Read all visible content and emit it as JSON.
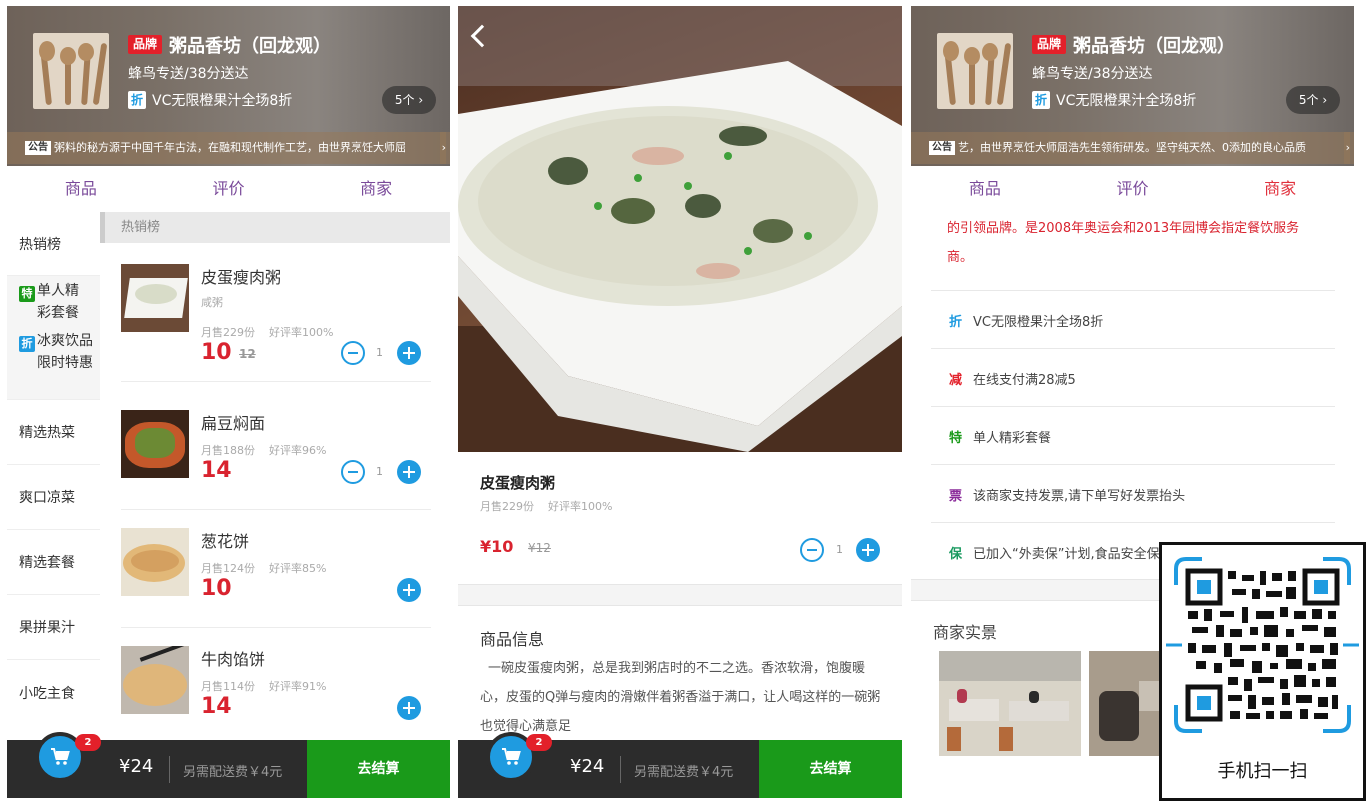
{
  "shop": {
    "brand_tag": "品牌",
    "name": "粥品香坊（回龙观）",
    "delivery": "蜂鸟专送/38分送达",
    "promo_icon": "折",
    "promo": "VC无限橙果汁全场8折",
    "promo_count": "5个 ›",
    "notice_tag": "公告",
    "notice_p1": "粥料的秘方源于中国千年古法，在融和现代制作工艺，由世界烹饪大师屈",
    "notice_p3": "艺，由世界烹饪大师屈浩先生领衔研发。坚守纯天然、0添加的良心品质",
    "notice_arrow": "›"
  },
  "tabs": [
    "商品",
    "评价",
    "商家"
  ],
  "categories": [
    {
      "label": "热销榜"
    },
    {
      "tag": "特",
      "tag_color": "#1a9a1a",
      "label": "单人精彩套餐"
    },
    {
      "tag": "折",
      "tag_color": "#1f9be0",
      "label": "冰爽饮品限时特惠"
    },
    {
      "label": "精选热菜"
    },
    {
      "label": "爽口凉菜"
    },
    {
      "label": "精选套餐"
    },
    {
      "label": "果拼果汁"
    },
    {
      "label": "小吃主食"
    }
  ],
  "section_title": "热销榜",
  "products": [
    {
      "name": "皮蛋瘦肉粥",
      "desc": "咸粥",
      "sales": "月售229份",
      "rating": "好评率100%",
      "price": "10",
      "old_price": "12",
      "qty": "1"
    },
    {
      "name": "扁豆焖面",
      "desc": "",
      "sales": "月售188份",
      "rating": "好评率96%",
      "price": "14",
      "old_price": "",
      "qty": "1"
    },
    {
      "name": "葱花饼",
      "desc": "",
      "sales": "月售124份",
      "rating": "好评率85%",
      "price": "10",
      "old_price": "",
      "qty": ""
    },
    {
      "name": "牛肉馅饼",
      "desc": "",
      "sales": "月售114份",
      "rating": "好评率91%",
      "price": "14",
      "old_price": "",
      "qty": ""
    }
  ],
  "cart": {
    "badge": "2",
    "total": "¥24",
    "delivery_fee": "另需配送费￥4元",
    "checkout": "去结算"
  },
  "detail": {
    "name": "皮蛋瘦肉粥",
    "sales": "月售229份",
    "rating": "好评率100%",
    "price": "¥10",
    "old_price": "¥12",
    "qty": "1",
    "info_title": "商品信息",
    "info_body": "一碗皮蛋瘦肉粥，总是我到粥店时的不二之选。香浓软滑，饱腹暖心，皮蛋的Q弹与瘦肉的滑嫩伴着粥香溢于满口，让人喝这样的一碗粥也觉得心满意足"
  },
  "merchant": {
    "desc": "的引领品牌。是2008年奥运会和2013年园博会指定餐饮服务商。",
    "supports": [
      {
        "icon": "折",
        "color": "#1f9be0",
        "text": "VC无限橙果汁全场8折"
      },
      {
        "icon": "减",
        "color": "#e3202a",
        "text": "在线支付满28减5"
      },
      {
        "icon": "特",
        "color": "#1a9a1a",
        "text": "单人精彩套餐"
      },
      {
        "icon": "票",
        "color": "#8a2a9a",
        "text": "该商家支持发票,请下单写好发票抬头"
      },
      {
        "icon": "保",
        "color": "#1a9a60",
        "text": "已加入“外卖保”计划,食品安全保障"
      }
    ],
    "photos_title": "商家实景"
  },
  "qr": {
    "caption": "手机扫一扫"
  },
  "colors": {
    "accent": "#1f9be0",
    "price": "#d9232f",
    "checkout": "#1a9a1a",
    "tab": "#7a4a9a"
  }
}
